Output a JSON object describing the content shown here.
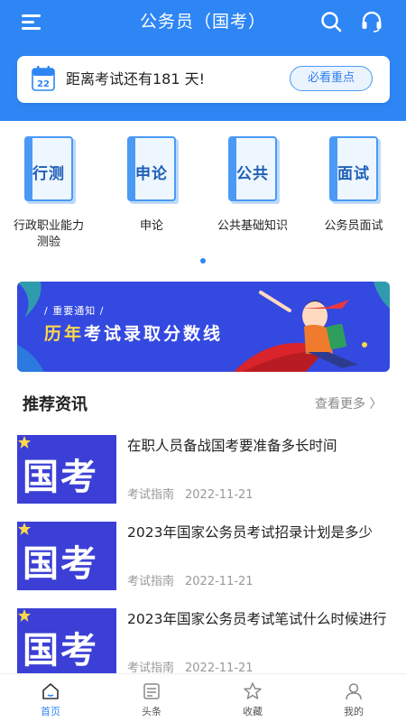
{
  "header": {
    "title": "公务员（国考）",
    "menu_icon": "menu-icon",
    "search_icon": "search-icon",
    "support_icon": "headset-icon"
  },
  "countdown": {
    "calendar_day": "22",
    "text": "距离考试还有181 天!",
    "button_label": "必看重点"
  },
  "categories": [
    {
      "book_label": "行测",
      "label_line1": "行政职业能力",
      "label_line2": "测验"
    },
    {
      "book_label": "申论",
      "label_line1": "申论",
      "label_line2": ""
    },
    {
      "book_label": "公共",
      "label_line1": "公共基础知识",
      "label_line2": ""
    },
    {
      "book_label": "面试",
      "label_line1": "公务员面试",
      "label_line2": ""
    }
  ],
  "banner": {
    "tag": "/ 重要通知 /",
    "title_highlight": "历年",
    "title_rest": "考试录取分数线"
  },
  "recommend": {
    "title": "推荐资讯",
    "more_label": "查看更多 〉"
  },
  "articles": [
    {
      "thumb_text": "国考",
      "title": "在职人员备战国考要准备多长时间",
      "category": "考试指南",
      "date": "2022-11-21"
    },
    {
      "thumb_text": "国考",
      "title": "2023年国家公务员考试招录计划是多少",
      "category": "考试指南",
      "date": "2022-11-21"
    },
    {
      "thumb_text": "国考",
      "title": "2023年国家公务员考试笔试什么时候进行",
      "category": "考试指南",
      "date": "2022-11-21"
    }
  ],
  "tabs": [
    {
      "label": "首页",
      "icon": "home-icon",
      "active": true
    },
    {
      "label": "头条",
      "icon": "news-icon",
      "active": false
    },
    {
      "label": "收藏",
      "icon": "star-icon",
      "active": false
    },
    {
      "label": "我的",
      "icon": "user-icon",
      "active": false
    }
  ],
  "colors": {
    "primary": "#2e86f4",
    "banner_bg": "#3449e0",
    "highlight": "#ffd84a",
    "book_blue": "#1e5fb8"
  }
}
